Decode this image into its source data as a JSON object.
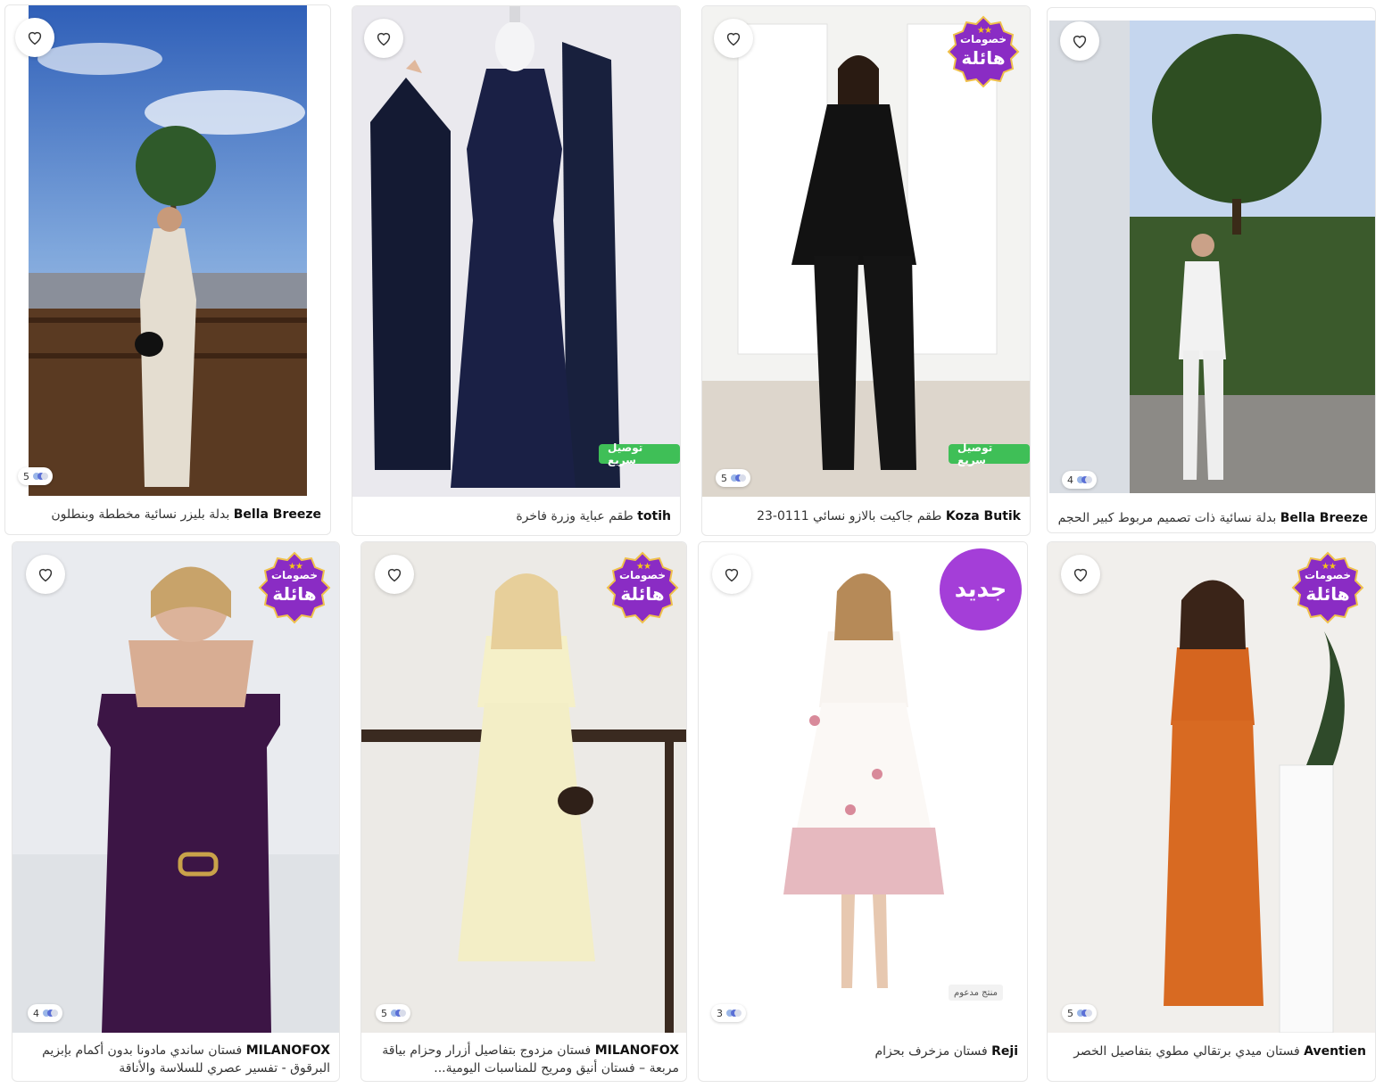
{
  "products": [
    {
      "brand": "Bella Breeze",
      "name": "بدلة بليزر نسائية مخططة وبنطلون",
      "colors": "5",
      "fast_label": "",
      "promo": false,
      "new_label": "",
      "sponsored_label": ""
    },
    {
      "brand": "totih",
      "name": "طقم عباية وزرة فاخرة",
      "colors": "",
      "fast_label": "توصيل سريع",
      "promo": false,
      "new_label": "",
      "sponsored_label": ""
    },
    {
      "brand": "Koza Butik",
      "name": "طقم جاكيت بالازو نسائي 0111-23",
      "colors": "5",
      "fast_label": "توصيل سريع",
      "promo": true,
      "new_label": "",
      "sponsored_label": ""
    },
    {
      "brand": "Bella Breeze",
      "name": "بدلة نسائية ذات تصميم مربوط كبير الحجم",
      "colors": "4",
      "fast_label": "",
      "promo": false,
      "new_label": "",
      "sponsored_label": ""
    },
    {
      "brand": "MILANOFOX",
      "name": "فستان ساندي مادونا بدون أكمام بإبزيم البرقوق - تفسير عصري للسلاسة والأناقة",
      "colors": "4",
      "fast_label": "",
      "promo": true,
      "new_label": "",
      "sponsored_label": ""
    },
    {
      "brand": "MILANOFOX",
      "name": "فستان مزدوج بتفاصيل أزرار وحزام بياقة مربعة – فستان أنيق ومريح للمناسبات اليومية...",
      "colors": "5",
      "fast_label": "",
      "promo": true,
      "new_label": "",
      "sponsored_label": ""
    },
    {
      "brand": "Reji",
      "name": "فستان مزخرف بحزام",
      "colors": "3",
      "fast_label": "",
      "promo": false,
      "new_label": "جديد",
      "sponsored_label": "منتج مدعوم"
    },
    {
      "brand": "Aventien",
      "name": "فستان ميدي برتقالي مطوي بتفاصيل الخصر",
      "colors": "5",
      "fast_label": "",
      "promo": true,
      "new_label": "",
      "sponsored_label": ""
    }
  ],
  "promo_badge": {
    "line1": "خصومات",
    "line2": "هائلة"
  },
  "colors": {
    "fast": "#3fbf57",
    "promo": "#8a2cc4",
    "new": "#a43ed8"
  },
  "icons": {
    "favorite": "heart-outline-icon",
    "promo": "star-badge-icon",
    "colors": "color-dots-icon"
  }
}
